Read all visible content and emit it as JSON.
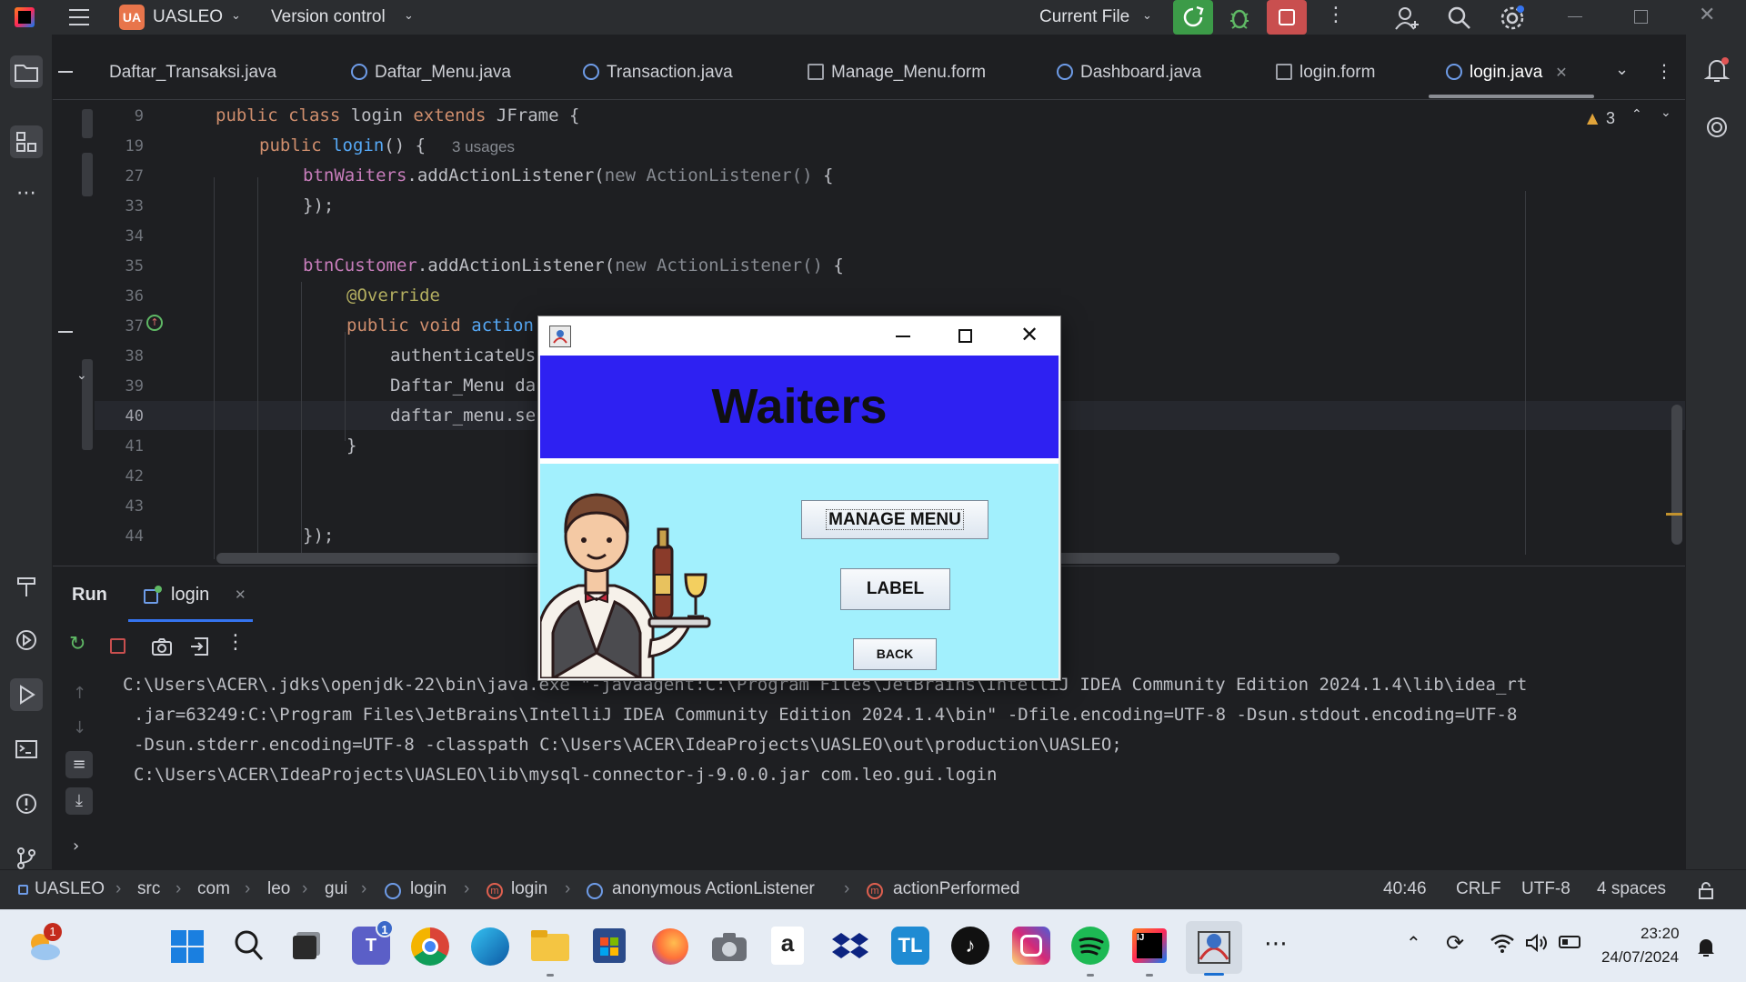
{
  "titlebar": {
    "project_badge": "UA",
    "project_name": "UASLEO",
    "vcs_label": "Version control",
    "run_config": "Current File"
  },
  "tabs": [
    {
      "label": "Daftar_Transaksi.java"
    },
    {
      "label": "Daftar_Menu.java"
    },
    {
      "label": "Transaction.java"
    },
    {
      "label": "Manage_Menu.form"
    },
    {
      "label": "Dashboard.java"
    },
    {
      "label": "login.form"
    },
    {
      "label": "login.java",
      "active": true
    }
  ],
  "editor": {
    "warning_count": "3",
    "usage_hint": "3 usages",
    "lines": [
      {
        "num": "9",
        "text": "public class login extends JFrame {"
      },
      {
        "num": "19",
        "text": "public login() {"
      },
      {
        "num": "27",
        "text": "btnWaiters.addActionListener(new ActionListener() {"
      },
      {
        "num": "33",
        "text": "});"
      },
      {
        "num": "34",
        "text": ""
      },
      {
        "num": "35",
        "text": "btnCustomer.addActionListener(new ActionListener() {"
      },
      {
        "num": "36",
        "text": "@Override"
      },
      {
        "num": "37",
        "text": "public void action"
      },
      {
        "num": "38",
        "text": "authenticateUs"
      },
      {
        "num": "39",
        "text": "Daftar_Menu da"
      },
      {
        "num": "40",
        "text": "daftar_menu.se"
      },
      {
        "num": "41",
        "text": "}"
      },
      {
        "num": "42",
        "text": ""
      },
      {
        "num": "43",
        "text": ""
      },
      {
        "num": "44",
        "text": "});"
      }
    ]
  },
  "run_panel": {
    "title": "Run",
    "tab_label": "login",
    "console_lines": [
      "C:\\Users\\ACER\\.jdks\\openjdk-22\\bin\\java.exe \"-javaagent:C:\\Program Files\\JetBrains\\IntelliJ IDEA Community Edition 2024.1.4\\lib\\idea_rt",
      ".jar=63249:C:\\Program Files\\JetBrains\\IntelliJ IDEA Community Edition 2024.1.4\\bin\" -Dfile.encoding=UTF-8 -Dsun.stdout.encoding=UTF-8",
      "-Dsun.stderr.encoding=UTF-8 -classpath C:\\Users\\ACER\\IdeaProjects\\UASLEO\\out\\production\\UASLEO;",
      "C:\\Users\\ACER\\IdeaProjects\\UASLEO\\lib\\mysql-connector-j-9.0.0.jar com.leo.gui.login"
    ]
  },
  "statusbar": {
    "breadcrumbs": [
      "UASLEO",
      "src",
      "com",
      "leo",
      "gui",
      "login",
      "login",
      "anonymous ActionListener",
      "actionPerformed"
    ],
    "position": "40:46",
    "line_sep": "CRLF",
    "encoding": "UTF-8",
    "indent": "4 spaces"
  },
  "dialog": {
    "heading": "Waiters",
    "manage_menu_label": "MANAGE MENU",
    "label_button": "LABEL",
    "back_button": "BACK"
  },
  "taskbar": {
    "weather_badge": "1",
    "teams_badge": "1",
    "clock_time": "23:20",
    "clock_date": "24/07/2024"
  },
  "colors": {
    "dialog_header": "#2e21f2",
    "dialog_body": "#a2f0fd",
    "run_green": "#3c9b48",
    "stop_red": "#c94f4f"
  }
}
